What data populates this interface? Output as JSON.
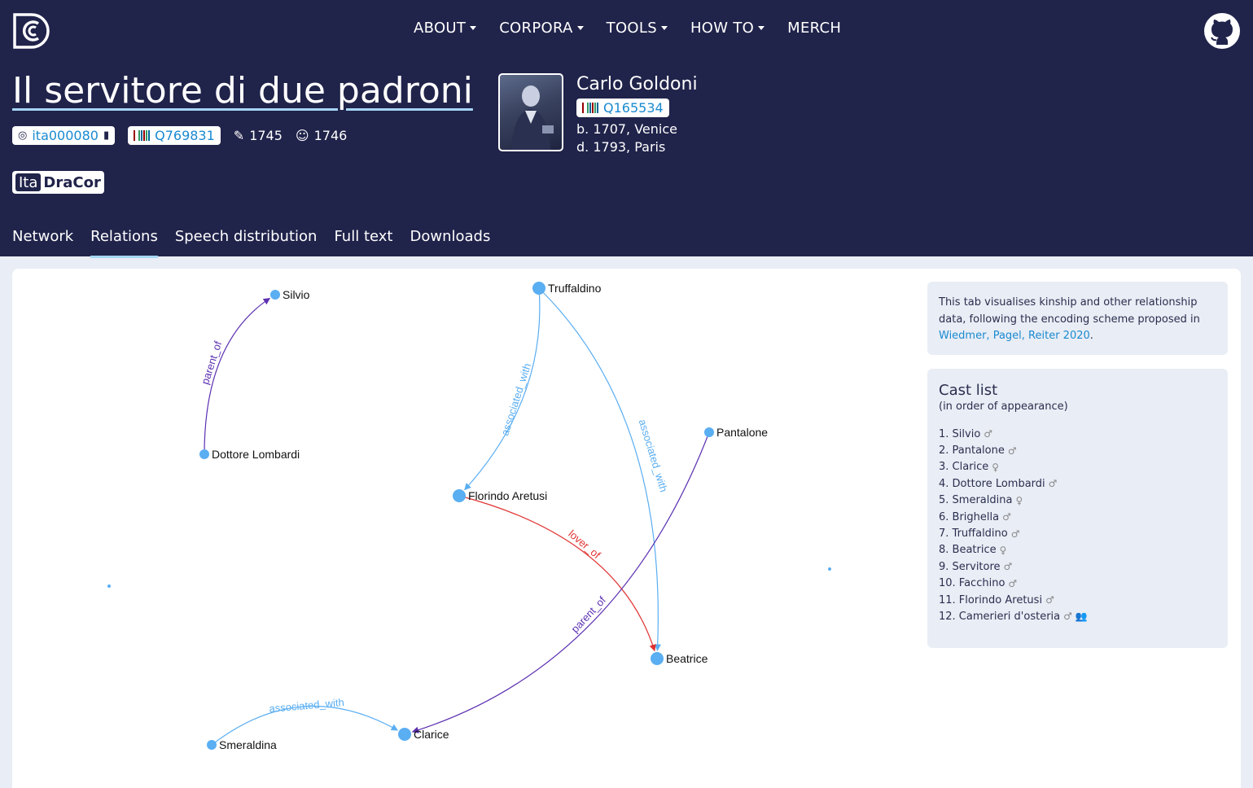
{
  "nav": {
    "items": [
      {
        "label": "ABOUT",
        "dropdown": true
      },
      {
        "label": "CORPORA",
        "dropdown": true
      },
      {
        "label": "TOOLS",
        "dropdown": true
      },
      {
        "label": "HOW TO",
        "dropdown": true
      },
      {
        "label": "MERCH",
        "dropdown": false
      }
    ]
  },
  "play": {
    "title": "Il servitore di due padroni",
    "id": "ita000080",
    "wikidata": "Q769831",
    "written_year": "1745",
    "premiere_year": "1746",
    "corpus_prefix": "Ita",
    "corpus_name": "DraCor"
  },
  "author": {
    "name": "Carlo Goldoni",
    "wikidata": "Q165534",
    "born": "b. 1707, Venice",
    "died": "d. 1793, Paris"
  },
  "tabs": [
    "Network",
    "Relations",
    "Speech distribution",
    "Full text",
    "Downloads"
  ],
  "active_tab": "Relations",
  "info": {
    "text": "This tab visualises kinship and other relationship data, following the encoding scheme proposed in ",
    "link": "Wiedmer, Pagel, Reiter 2020",
    "after": "."
  },
  "cast": {
    "title": "Cast list",
    "subtitle": "(in order of appearance)",
    "items": [
      {
        "n": "1.",
        "name": "Silvio",
        "gender": "♂"
      },
      {
        "n": "2.",
        "name": "Pantalone",
        "gender": "♂"
      },
      {
        "n": "3.",
        "name": "Clarice",
        "gender": "♀"
      },
      {
        "n": "4.",
        "name": "Dottore Lombardi",
        "gender": "♂"
      },
      {
        "n": "5.",
        "name": "Smeraldina",
        "gender": "♀"
      },
      {
        "n": "6.",
        "name": "Brighella",
        "gender": "♂"
      },
      {
        "n": "7.",
        "name": "Truffaldino",
        "gender": "♂"
      },
      {
        "n": "8.",
        "name": "Beatrice",
        "gender": "♀"
      },
      {
        "n": "9.",
        "name": "Servitore",
        "gender": "♂"
      },
      {
        "n": "10.",
        "name": "Facchino",
        "gender": "♂"
      },
      {
        "n": "11.",
        "name": "Florindo Aretusi",
        "gender": "♂"
      },
      {
        "n": "12.",
        "name": "Camerieri d'osteria",
        "gender": "♂",
        "group": true
      }
    ]
  },
  "graph": {
    "nodes": [
      {
        "id": "silvio",
        "label": "Silvio"
      },
      {
        "id": "truffaldino",
        "label": "Truffaldino"
      },
      {
        "id": "dottore",
        "label": "Dottore Lombardi"
      },
      {
        "id": "pantalone",
        "label": "Pantalone"
      },
      {
        "id": "florindo",
        "label": "Florindo Aretusi"
      },
      {
        "id": "beatrice",
        "label": "Beatrice"
      },
      {
        "id": "smeraldina",
        "label": "Smeraldina"
      },
      {
        "id": "clarice",
        "label": "Clarice"
      },
      {
        "id": "iso1",
        "label": ""
      },
      {
        "id": "iso2",
        "label": ""
      }
    ],
    "edges": [
      {
        "from": "dottore",
        "to": "silvio",
        "label": "parent_of",
        "color": "#5b2fb1"
      },
      {
        "from": "truffaldino",
        "to": "florindo",
        "label": "associated_with",
        "color": "#5aaef2"
      },
      {
        "from": "truffaldino",
        "to": "beatrice",
        "label": "associated_with",
        "color": "#5aaef2"
      },
      {
        "from": "florindo",
        "to": "beatrice",
        "label": "lover_of",
        "color": "#e03131"
      },
      {
        "from": "pantalone",
        "to": "clarice",
        "label": "parent_of",
        "color": "#5b2fb1"
      },
      {
        "from": "smeraldina",
        "to": "clarice",
        "label": "associated_with",
        "color": "#5aaef2"
      }
    ],
    "node_color": "#5aaef2"
  }
}
